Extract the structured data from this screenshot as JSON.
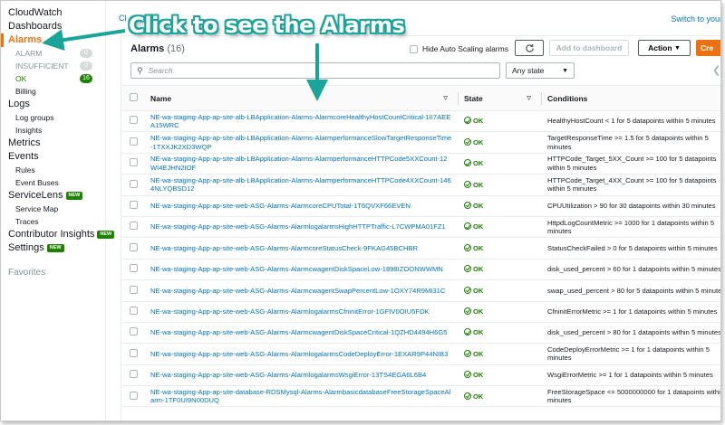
{
  "annotation": {
    "text": "Click to see the Alarms"
  },
  "topbar": {
    "crumb": "Cl",
    "switch_link": "Switch to your"
  },
  "sidebar": {
    "items": [
      {
        "label": "CloudWatch"
      },
      {
        "label": "Dashboards"
      },
      {
        "label": "Alarms"
      },
      {
        "label": "ALARM",
        "count": "0"
      },
      {
        "label": "INSUFFICIENT",
        "count": "0"
      },
      {
        "label": "OK",
        "count": "16"
      },
      {
        "label": "Billing"
      },
      {
        "label": "Logs"
      },
      {
        "label": "Log groups"
      },
      {
        "label": "Insights"
      },
      {
        "label": "Metrics"
      },
      {
        "label": "Events"
      },
      {
        "label": "Rules"
      },
      {
        "label": "Event Buses"
      },
      {
        "label": "ServiceLens",
        "badge": "NEW"
      },
      {
        "label": "Service Map"
      },
      {
        "label": "Traces"
      },
      {
        "label": "Contributor Insights",
        "badge": "NEW"
      },
      {
        "label": "Settings",
        "badge": "NEW"
      }
    ],
    "favorites": "Favorites"
  },
  "panel": {
    "title": "Alarms",
    "count": "(16)",
    "hide_autoscaling": "Hide Auto Scaling alarms",
    "refresh_icon": "refresh-icon",
    "add_dashboard": "Add to dashboard",
    "action": "Action",
    "create": "Cre",
    "search_placeholder": "Search",
    "state_filter": "Any state"
  },
  "table": {
    "columns": [
      "Name",
      "State",
      "Conditions"
    ],
    "rows": [
      {
        "name": "NE-wa-staging-App-ap-site-alb-LBApplication-Alarms-AlarmcoreHealthyHostCountCritical-1II7AEEA15WRC",
        "state": "OK",
        "cond": "HealthyHostCount < 1 for 5 datapoints within 5 minutes"
      },
      {
        "name": "NE-wa-staging-App-ap-site-alb-LBApplication-Alarms-AlarmperformanceSlowTargetResponseTime-1TXXJK2XD3WQP",
        "state": "OK",
        "cond": "TargetResponseTime >= 1.5 for 5 datapoints within 5 minutes"
      },
      {
        "name": "NE-wa-staging-App-ap-site-alb-LBApplication-Alarms-AlarmperformanceHTTPCode5XXCount-12WI4EJHN2IOF",
        "state": "OK",
        "cond": "HTTPCode_Target_5XX_Count >= 100 for 5 datapoints within 5 minutes"
      },
      {
        "name": "NE-wa-staging-App-ap-site-alb-LBApplication-Alarms-AlarmperformanceHTTPCode4XXCount-1464NLYQBSD12",
        "state": "OK",
        "cond": "HTTPCode_Target_4XX_Count >= 100 for 5 datapoints within 5 minutes"
      },
      {
        "name": "NE-wa-staging-App-ap-site-web-ASG-Alarms-AlarmcoreCPUTotal-1T6QVXF66EVEN",
        "state": "OK",
        "cond": "CPUUtilization > 90 for 30 datapoints within 30 minutes"
      },
      {
        "name": "NE-wa-staging-App-ap-site-web-ASG-Alarms-AlarmlogalarmsHighHTTPTraffic-L7CWPMA01FZ1",
        "state": "OK",
        "cond": "HttpdLogCountMetric >= 1000 for 1 datapoints within 5 minutes"
      },
      {
        "name": "NE-wa-staging-App-ap-site-web-ASG-Alarms-AlarmcoreStatusCheck-9FKAG45BCHBR",
        "state": "OK",
        "cond": "StatusCheckFailed > 0 for 5 datapoints within 5 minutes"
      },
      {
        "name": "NE-wa-staging-App-ap-site-web-ASG-Alarms-AlarmcwagentDiskSpaceLow-1898IZOONWWMN",
        "state": "OK",
        "cond": "disk_used_percent > 60 for 1 datapoints within 5 minutes"
      },
      {
        "name": "NE-wa-staging-App-ap-site-web-ASG-Alarms-AlarmcwagentSwapPercentLow-1OXY74R9MI31C",
        "state": "OK",
        "cond": "swap_used_percent > 80 for 5 datapoints within 5 minutes"
      },
      {
        "name": "NE-wa-staging-App-ap-site-web-ASG-Alarms-AlarmlogalarmsCfninitError-1GFIV0OIU5FDK",
        "state": "OK",
        "cond": "CfninitErrorMetric >= 1 for 1 datapoints within 5 minutes"
      },
      {
        "name": "NE-wa-staging-App-ap-site-web-ASG-Alarms-AlarmcwagentDiskSpaceCritical-1QZHD4494H6G5",
        "state": "OK",
        "cond": "disk_used_percent > 80 for 1 datapoints within 5 minutes"
      },
      {
        "name": "NE-wa-staging-App-ap-site-web-ASG-Alarms-AlarmlogalarmsCodeDeployError-1EXAR9P44NIB3",
        "state": "OK",
        "cond": "CodeDeployErrorMetric >= 1 for 1 datapoints within 5 minutes"
      },
      {
        "name": "NE-wa-staging-App-ap-site-web-ASG-Alarms-AlarmlogalarmsWsgiError-13TS4EGA6L6B4",
        "state": "OK",
        "cond": "WsgiErrorMetric >= 1 for 1 datapoints within 5 minutes"
      },
      {
        "name": "NE-wa-staging-App-ap-site-database-RDSMysql-Alarms-AlarmbasicdatabaseFreeStorageSpaceAlarm-1TF0UI9N00DUQ",
        "state": "OK",
        "cond": "FreeStorageSpace <= 5000000000 for 1 datapoints within 5 minutes"
      }
    ]
  },
  "colors": {
    "accent": "#ec7211",
    "link": "#0073bb",
    "ok": "#1d8102",
    "annotation": "#1aa59a"
  }
}
